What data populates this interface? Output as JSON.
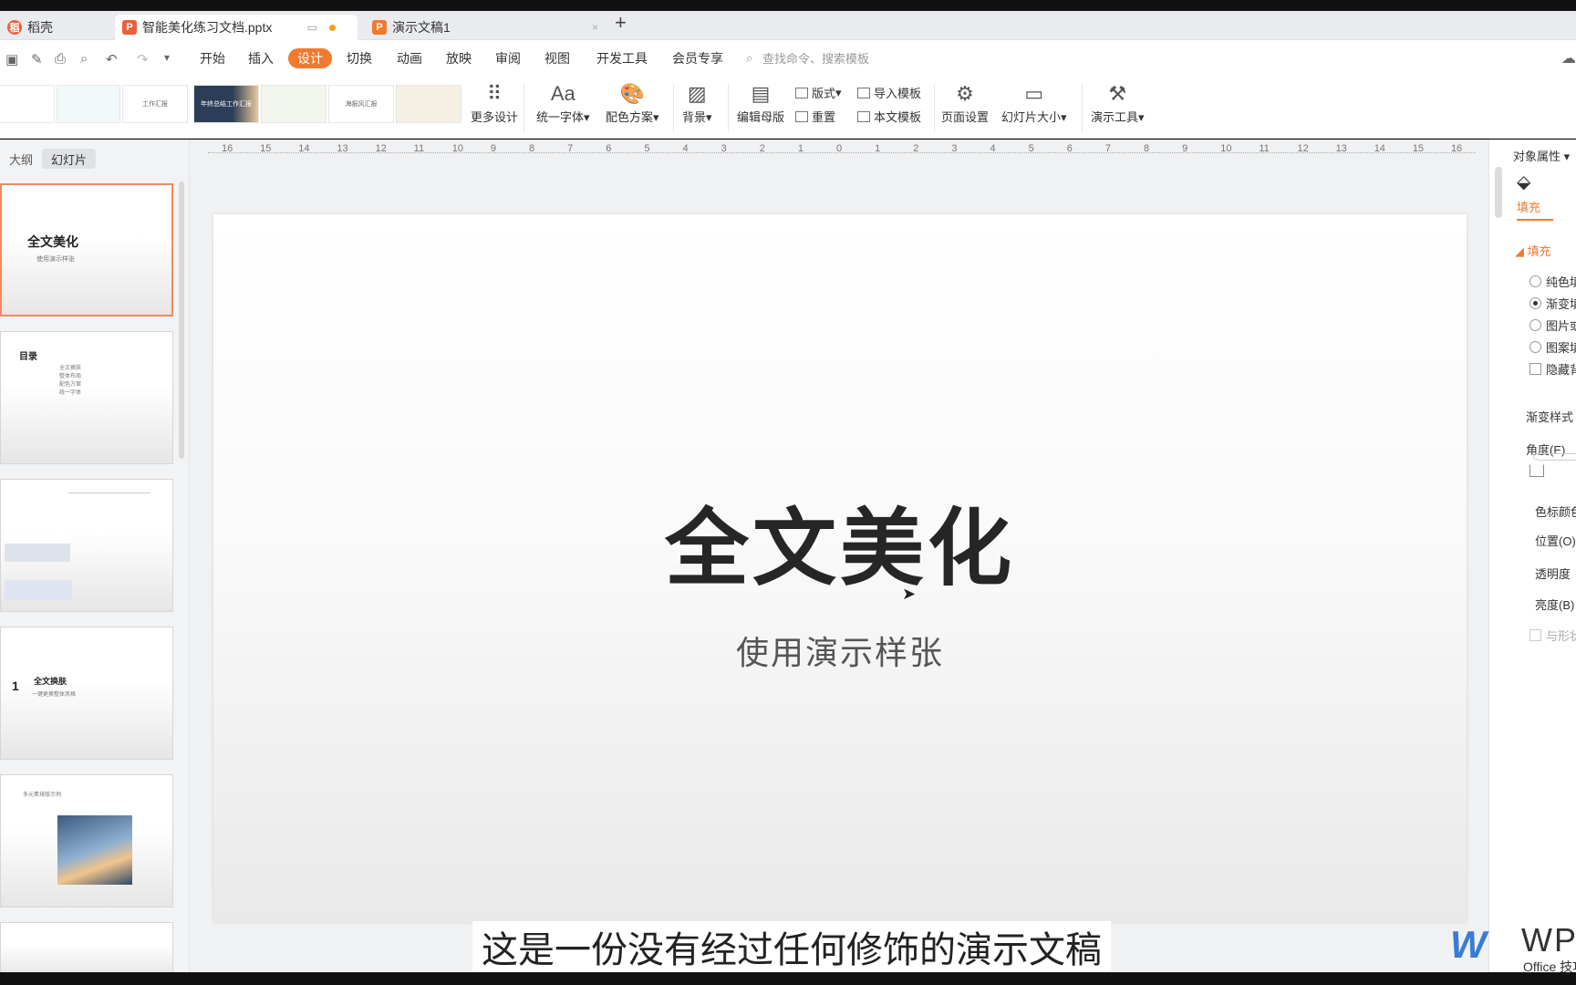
{
  "tabs": [
    {
      "label": "稻壳",
      "icon": "docer-icon"
    },
    {
      "label": "智能美化练习文档.pptx",
      "icon": "pptx-icon"
    },
    {
      "label": "演示文稿1",
      "icon": "pptx-icon"
    }
  ],
  "menu": [
    "开始",
    "插入",
    "设计",
    "切换",
    "动画",
    "放映",
    "审阅",
    "视图",
    "开发工具",
    "会员专享"
  ],
  "active_menu": "设计",
  "search_placeholder": "查找命令、搜索模板",
  "ribbon": {
    "more_design": "更多设计",
    "unify_font": "统一字体",
    "color_scheme": "配色方案",
    "background": "背景",
    "edit_master": "编辑母版",
    "layout": "版式",
    "reset": "重置",
    "import_template": "导入模板",
    "body_template": "本文模板",
    "page_setup": "页面设置",
    "slide_size": "幻灯片大小",
    "presentation_tools": "演示工具",
    "font_glyph": "Aa",
    "theme_thumbs": [
      "",
      "",
      "工作汇报",
      "年终总结工作汇报",
      "",
      "",
      "海报风汇报",
      ""
    ]
  },
  "left_panel": {
    "tabs": [
      "大纲",
      "幻灯片"
    ],
    "slides": [
      {
        "title": "全文美化",
        "subtitle": "使用演示样张"
      },
      {
        "title": "目录",
        "items": [
          "全文换肤",
          "整体布局",
          "配色方案",
          "统一字体"
        ]
      },
      {
        "title": "",
        "subtitle": ""
      },
      {
        "number": "1",
        "title": "全文换肤",
        "subtitle": "一键更换整体风格"
      },
      {
        "title": "多元素排版示例",
        "subtitle": ""
      }
    ]
  },
  "ruler": [
    "16",
    "15",
    "14",
    "13",
    "12",
    "11",
    "10",
    "9",
    "8",
    "7",
    "6",
    "5",
    "4",
    "3",
    "2",
    "1",
    "0",
    "1",
    "2",
    "3",
    "4",
    "5",
    "6",
    "7",
    "8",
    "9",
    "10",
    "11",
    "12",
    "13",
    "14",
    "15",
    "16"
  ],
  "slide": {
    "title": "全文美化",
    "subtitle": "使用演示样张"
  },
  "caption": "这是一份没有经过任何修饰的演示文稿",
  "right_panel": {
    "header": "对象属性",
    "fill_tab": "填充",
    "fill_section": "填充",
    "options": [
      "纯色填充",
      "渐变填充",
      "图片或纹理填充",
      "图案填充"
    ],
    "selected_option": "渐变填充",
    "hide_bg": "隐藏背景图形",
    "gradient_style": "渐变样式",
    "angle": "角度(E)",
    "stop_color": "色标颜色",
    "position": "位置(O)",
    "transparency": "透明度",
    "brightness": "亮度(B)",
    "with_shape": "与形状一起旋转"
  },
  "watermark": {
    "brand": "WPS",
    "sub": "Office 技巧"
  }
}
